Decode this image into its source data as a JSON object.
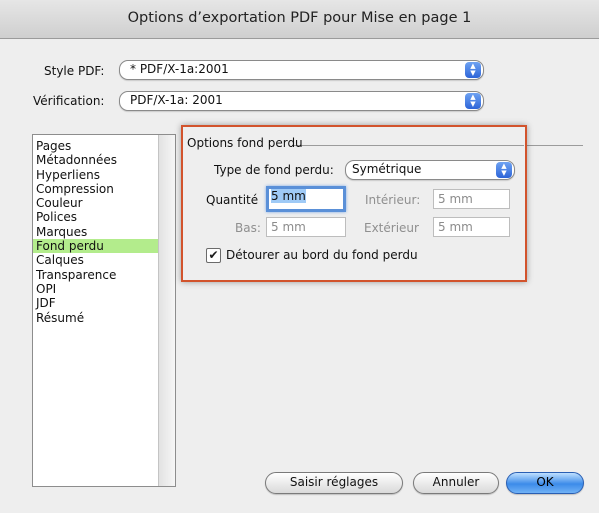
{
  "window": {
    "title": "Options d’exportation PDF pour Mise en page 1"
  },
  "style_pdf": {
    "label": "Style PDF:",
    "value": "* PDF/X-1a:2001"
  },
  "verification": {
    "label": "Vérification:",
    "value": "PDF/X-1a: 2001"
  },
  "sidebar": {
    "items": [
      {
        "label": "Pages"
      },
      {
        "label": "Métadonnées"
      },
      {
        "label": "Hyperliens"
      },
      {
        "label": "Compression"
      },
      {
        "label": "Couleur"
      },
      {
        "label": "Polices"
      },
      {
        "label": "Marques"
      },
      {
        "label": "Fond perdu",
        "selected": true
      },
      {
        "label": "Calques"
      },
      {
        "label": "Transparence"
      },
      {
        "label": "OPI"
      },
      {
        "label": "JDF"
      },
      {
        "label": "Résumé"
      }
    ]
  },
  "bleed": {
    "group_title": "Options fond perdu",
    "type_label": "Type de fond perdu:",
    "type_value": "Symétrique",
    "quantite_label": "Quantité",
    "quantite_value": "5 mm",
    "interieur_label": "Intérieur:",
    "interieur_value": "5 mm",
    "bas_label": "Bas:",
    "bas_value": "5 mm",
    "exterieur_label": "Extérieur",
    "exterieur_value": "5 mm",
    "clip_label": "Détourer au bord du fond perdu",
    "clip_checked": true
  },
  "footer": {
    "saisir_label": "Saisir réglages",
    "annuler_label": "Annuler",
    "ok_label": "OK"
  },
  "colors": {
    "selection": "#b3ec8c",
    "highlight_border": "#d2532c",
    "accent": "#3c8be9"
  }
}
